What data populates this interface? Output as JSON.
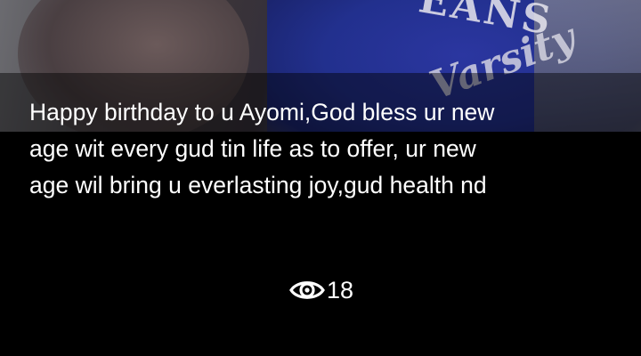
{
  "status": {
    "caption_lines": [
      "Happy birthday to u Ayomi,God bless ur new",
      "age wit every gud tin life as to offer, ur new",
      "age wil bring u everlasting joy,gud health nd"
    ],
    "view_count": "18",
    "view_icon": "eye-icon"
  },
  "photo_print": {
    "top_text": "EANS",
    "script_text": "Varsity"
  },
  "colors": {
    "background": "#000000",
    "caption_text": "#ffffff",
    "shirt_blue": "#22308e"
  }
}
